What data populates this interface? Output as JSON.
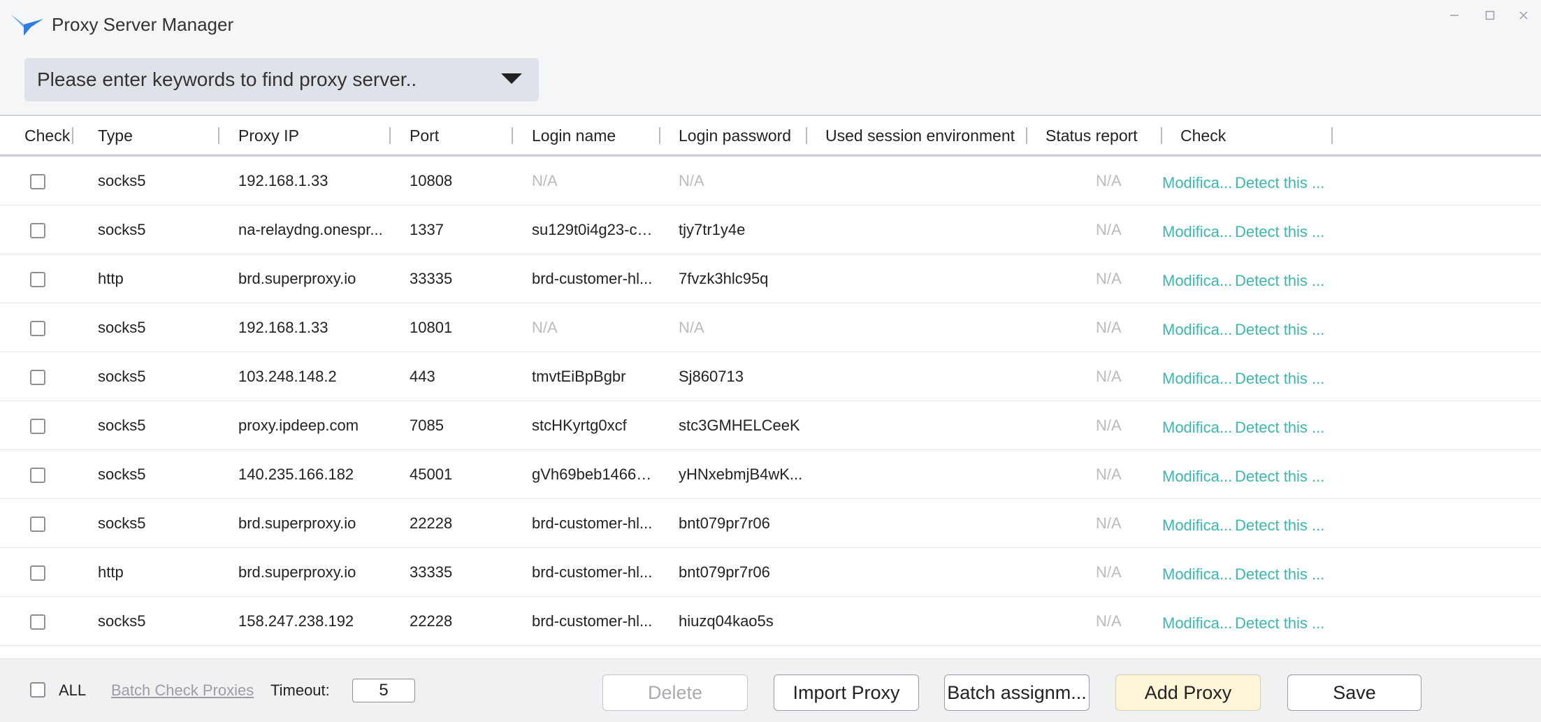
{
  "window": {
    "title": "Proxy Server Manager",
    "controls": [
      "minimize",
      "maximize",
      "close"
    ]
  },
  "search": {
    "placeholder": "Please enter keywords to find proxy server.."
  },
  "table": {
    "columns": [
      {
        "key": "check",
        "label": "Check"
      },
      {
        "key": "type",
        "label": "Type"
      },
      {
        "key": "proxy_ip",
        "label": "Proxy IP"
      },
      {
        "key": "port",
        "label": "Port"
      },
      {
        "key": "login_name",
        "label": "Login name"
      },
      {
        "key": "login_password",
        "label": "Login password"
      },
      {
        "key": "used_session",
        "label": "Used session environment"
      },
      {
        "key": "status_report",
        "label": "Status report"
      },
      {
        "key": "actions",
        "label": "Check"
      }
    ],
    "rows": [
      {
        "type": "socks5",
        "proxy_ip": "192.168.1.33",
        "port": "10808",
        "login_name": "N/A",
        "login_password": "N/A",
        "used_session": "",
        "status_report": "N/A",
        "modify_label": "Modifica...",
        "detect_label": "Detect this ..."
      },
      {
        "type": "socks5",
        "proxy_ip": "na-relaydng.onespr...",
        "port": "1337",
        "login_name": "su129t0i4g23-co...",
        "login_password": "tjy7tr1y4e",
        "used_session": "",
        "status_report": "N/A",
        "modify_label": "Modifica...",
        "detect_label": "Detect this ..."
      },
      {
        "type": "http",
        "proxy_ip": "brd.superproxy.io",
        "port": "33335",
        "login_name": "brd-customer-hl...",
        "login_password": "7fvzk3hlc95q",
        "used_session": "",
        "status_report": "N/A",
        "modify_label": "Modifica...",
        "detect_label": "Detect this ..."
      },
      {
        "type": "socks5",
        "proxy_ip": "192.168.1.33",
        "port": "10801",
        "login_name": "N/A",
        "login_password": "N/A",
        "used_session": "",
        "status_report": "N/A",
        "modify_label": "Modifica...",
        "detect_label": "Detect this ..."
      },
      {
        "type": "socks5",
        "proxy_ip": "103.248.148.2",
        "port": "443",
        "login_name": "tmvtEiBpBgbr",
        "login_password": "Sj860713",
        "used_session": "",
        "status_report": "N/A",
        "modify_label": "Modifica...",
        "detect_label": "Detect this ..."
      },
      {
        "type": "socks5",
        "proxy_ip": "proxy.ipdeep.com",
        "port": "7085",
        "login_name": "stcHKyrtg0xcf",
        "login_password": "stc3GMHELCeeK",
        "used_session": "",
        "status_report": "N/A",
        "modify_label": "Modifica...",
        "detect_label": "Detect this ..."
      },
      {
        "type": "socks5",
        "proxy_ip": "140.235.166.182",
        "port": "45001",
        "login_name": "gVh69beb14669f...",
        "login_password": "yHNxebmjB4wK...",
        "used_session": "",
        "status_report": "N/A",
        "modify_label": "Modifica...",
        "detect_label": "Detect this ..."
      },
      {
        "type": "socks5",
        "proxy_ip": "brd.superproxy.io",
        "port": "22228",
        "login_name": "brd-customer-hl...",
        "login_password": "bnt079pr7r06",
        "used_session": "",
        "status_report": "N/A",
        "modify_label": "Modifica...",
        "detect_label": "Detect this ..."
      },
      {
        "type": "http",
        "proxy_ip": "brd.superproxy.io",
        "port": "33335",
        "login_name": "brd-customer-hl...",
        "login_password": "bnt079pr7r06",
        "used_session": "",
        "status_report": "N/A",
        "modify_label": "Modifica...",
        "detect_label": "Detect this ..."
      },
      {
        "type": "socks5",
        "proxy_ip": "158.247.238.192",
        "port": "22228",
        "login_name": "brd-customer-hl...",
        "login_password": "hiuzq04kao5s",
        "used_session": "",
        "status_report": "N/A",
        "modify_label": "Modifica...",
        "detect_label": "Detect this ..."
      }
    ]
  },
  "footer": {
    "all_label": "ALL",
    "batch_check_label": "Batch Check Proxies",
    "timeout_label": "Timeout:",
    "timeout_value": "5",
    "buttons": {
      "delete": "Delete",
      "import": "Import Proxy",
      "batch_assign": "Batch assignm...",
      "add": "Add Proxy",
      "save": "Save"
    }
  },
  "colors": {
    "accent_link": "#3bb7ae",
    "add_button_bg": "#fdf5d8",
    "logo_blue": "#2f7fe0",
    "muted_text": "#b8bcc2"
  },
  "icons": {
    "logo": "bird-logo-icon",
    "dropdown": "caret-down-icon",
    "minimize": "minimize-icon",
    "maximize": "maximize-icon",
    "close": "close-icon"
  }
}
